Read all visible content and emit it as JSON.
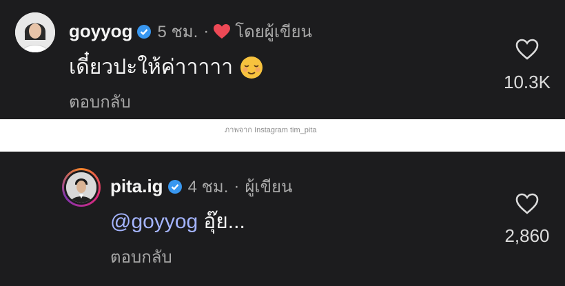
{
  "comments": [
    {
      "username": "goyyog",
      "time": "5 ชม.",
      "separator": "·",
      "author_note": "โดยผู้เขียน",
      "text": "เดี๋ยวปะให้ค่าาาาา",
      "emoji": "relieved-face-icon",
      "reply_label": "ตอบกลับ",
      "likes": "10.3K"
    },
    {
      "username": "pita.ig",
      "time": "4 ชม.",
      "separator": "·",
      "author_note": "ผู้เขียน",
      "mention": "@goyyog",
      "text": "อุ๊ย...",
      "reply_label": "ตอบกลับ",
      "likes": "2,860"
    }
  ],
  "caption": "ภาพจาก Instagram tim_pita",
  "colors": {
    "background": "#1c1c1e",
    "verified": "#3897f0",
    "heart": "#ed4956",
    "mention": "#a4b4ff"
  }
}
